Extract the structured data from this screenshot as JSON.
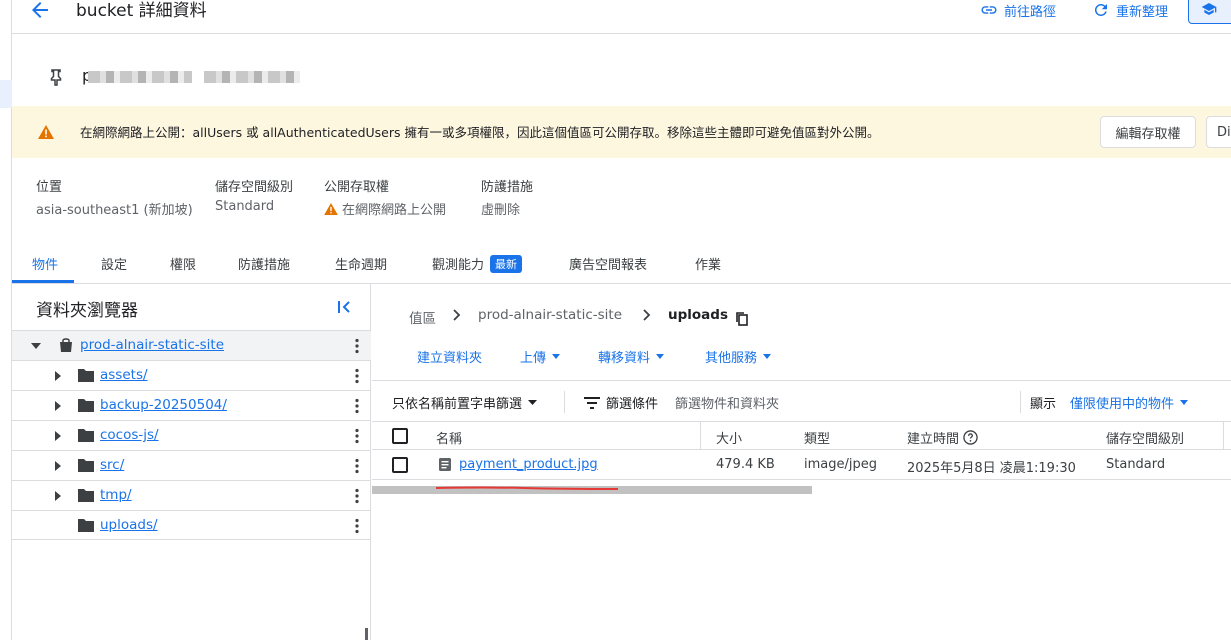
{
  "header": {
    "title": "bucket 詳細資料",
    "links": [
      {
        "label": "前往路徑",
        "icon": "link-icon"
      },
      {
        "label": "重新整理",
        "icon": "refresh-icon"
      }
    ]
  },
  "bucket_label_visible": "p",
  "banner": {
    "text": "在網際網路上公開：allUsers 或 allAuthenticatedUsers 擁有一或多項權限，因此這個值區可公開存取。移除這些主體即可避免值區對外公開。",
    "edit_button": "編輯存取權",
    "second_button": "Di"
  },
  "properties": [
    {
      "label": "位置",
      "value": "asia-southeast1 (新加坡)"
    },
    {
      "label": "儲存空間級別",
      "value": "Standard"
    },
    {
      "label": "公開存取權",
      "value": "在網際網路上公開"
    },
    {
      "label": "防護措施",
      "value": "虛刪除"
    }
  ],
  "tabs": [
    {
      "label": "物件",
      "active": true
    },
    {
      "label": "設定"
    },
    {
      "label": "權限"
    },
    {
      "label": "防護措施"
    },
    {
      "label": "生命週期"
    },
    {
      "label": "觀測能力",
      "badge": "最新"
    },
    {
      "label": "廣告空間報表"
    },
    {
      "label": "作業"
    }
  ],
  "folder_browser": {
    "title": "資料夾瀏覽器",
    "root": "prod-alnair-static-site",
    "folders": [
      "assets/",
      "backup-20250504/",
      "cocos-js/",
      "src/",
      "tmp/",
      "uploads/"
    ]
  },
  "breadcrumb": [
    "值區",
    "prod-alnair-static-site",
    "uploads"
  ],
  "actions": [
    {
      "label": "建立資料夾",
      "dropdown": false
    },
    {
      "label": "上傳",
      "dropdown": true
    },
    {
      "label": "轉移資料",
      "dropdown": true
    },
    {
      "label": "其他服務",
      "dropdown": true
    }
  ],
  "filter": {
    "prefix_filter": "只依名稱前置字串篩選",
    "filter_label": "篩選條件",
    "filter_placeholder": "篩選物件和資料夾",
    "show_label": "顯示",
    "show_value": "僅限使用中的物件"
  },
  "table": {
    "columns": [
      "名稱",
      "大小",
      "類型",
      "建立時間",
      "儲存空間級別"
    ],
    "rows": [
      {
        "name": "payment_product.jpg",
        "size": "479.4 KB",
        "type": "image/jpeg",
        "created": "2025年5月8日 凌晨1:19:30",
        "storage_class": "Standard"
      }
    ]
  },
  "colors": {
    "accent": "#1a73e8",
    "warning_bg": "#fef7e0",
    "warning_icon": "#e37400",
    "annotation": "#e53935"
  }
}
